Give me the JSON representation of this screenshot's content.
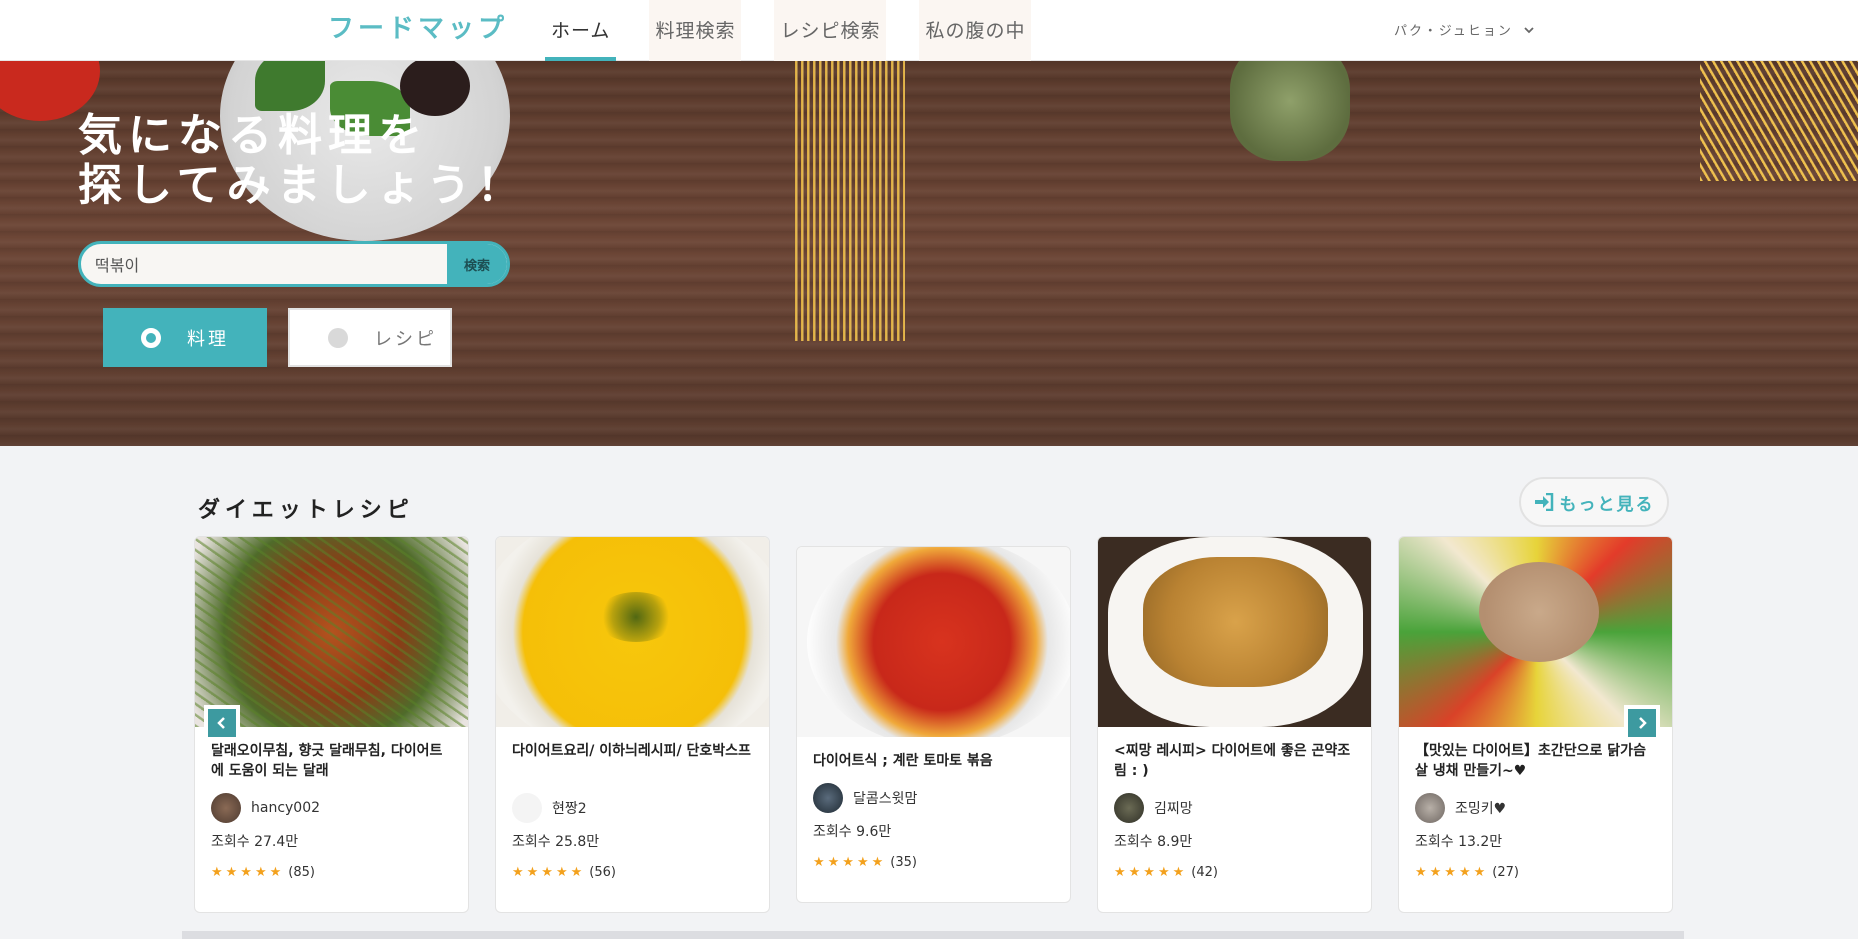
{
  "header": {
    "logo": "フードマップ",
    "nav": [
      {
        "label": "ホーム",
        "active": true
      },
      {
        "label": "料理検索",
        "active": false
      },
      {
        "label": "レシピ検索",
        "active": false
      },
      {
        "label": "私の腹の中",
        "active": false
      }
    ],
    "user_name": "パク・ジュヒョン"
  },
  "hero": {
    "title_line1": "気になる料理を",
    "title_line2": "探してみましょう！",
    "search": {
      "value": "떡볶이",
      "button_label": "検索"
    },
    "radios": [
      {
        "label": "料理",
        "selected": true
      },
      {
        "label": "レシピ",
        "selected": false
      }
    ]
  },
  "diet_section": {
    "title": "ダイエットレシピ",
    "more_label": "もっと見る",
    "cards": [
      {
        "title": "달래오이무침, 향긋 달래무침, 다이어트에 도움이 되는 달래",
        "author": "hancy002",
        "views": "조회수 27.4만",
        "stars": "★★★★★",
        "count": "(85)"
      },
      {
        "title": "다이어트요리/ 이하늬레시피/ 단호박스프",
        "author": "현짱2",
        "views": "조회수 25.8만",
        "stars": "★★★★★",
        "count": "(56)"
      },
      {
        "title": "다이어트식 ; 계란 토마토 볶음",
        "author": "달콤스윗맘",
        "views": "조회수 9.6만",
        "stars": "★★★★★",
        "count": "(35)"
      },
      {
        "title": "<찌망 레시피> 다이어트에 좋은 곤약조림 : )",
        "author": "김찌망",
        "views": "조회수 8.9만",
        "stars": "★★★★★",
        "count": "(42)"
      },
      {
        "title": "【맛있는 다이어트】초간단으로 닭가슴살 냉채 만들기~♥",
        "author": "조밍키♥",
        "views": "조회수 13.2만",
        "stars": "★★★★★",
        "count": "(27)"
      }
    ]
  },
  "colors": {
    "accent": "#43b3bb",
    "star": "#f3a11d",
    "logo": "#5bbcc4"
  }
}
